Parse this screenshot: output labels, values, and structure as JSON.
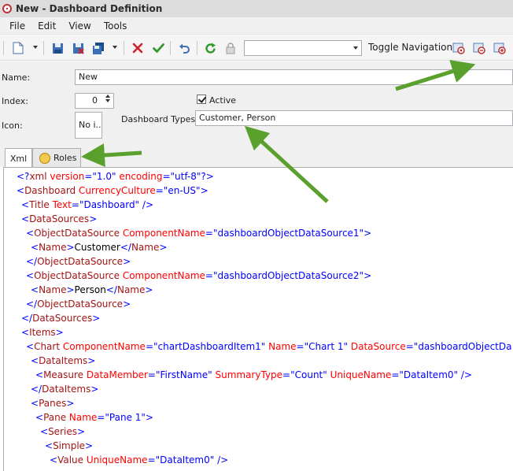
{
  "window": {
    "title": "New - Dashboard Definition"
  },
  "menu": [
    "File",
    "Edit",
    "View",
    "Tools"
  ],
  "toolbar": {
    "combo_value": "",
    "toggle_navigation": "Toggle Navigation"
  },
  "form": {
    "name_label": "Name:",
    "name_value": "New",
    "index_label": "Index:",
    "index_value": "0",
    "active_label": "Active",
    "active_checked": true,
    "icon_label": "Icon:",
    "icon_value": "No i...",
    "types_label": "Dashboard Types:",
    "types_value": "Customer, Person"
  },
  "tabs": [
    {
      "label": "Xml",
      "selected": true
    },
    {
      "label": "Roles",
      "selected": false
    }
  ],
  "xml_lines": [
    {
      "indent": 0,
      "tokens": [
        [
          "b",
          "<?"
        ],
        [
          "t",
          "xml"
        ],
        [
          "a",
          " version"
        ],
        [
          "b",
          "="
        ],
        [
          "v",
          "\"1.0\""
        ],
        [
          "a",
          " encoding"
        ],
        [
          "b",
          "="
        ],
        [
          "v",
          "\"utf-8\""
        ],
        [
          "b",
          "?>"
        ]
      ]
    },
    {
      "indent": 0,
      "tokens": [
        [
          "b",
          "<"
        ],
        [
          "t",
          "Dashboard"
        ],
        [
          "a",
          " CurrencyCulture"
        ],
        [
          "b",
          "="
        ],
        [
          "v",
          "\"en-US\""
        ],
        [
          "b",
          ">"
        ]
      ]
    },
    {
      "indent": 1,
      "tokens": [
        [
          "b",
          "<"
        ],
        [
          "t",
          "Title"
        ],
        [
          "a",
          " Text"
        ],
        [
          "b",
          "="
        ],
        [
          "v",
          "\"Dashboard\""
        ],
        [
          "b",
          " />"
        ]
      ]
    },
    {
      "indent": 1,
      "tokens": [
        [
          "b",
          "<"
        ],
        [
          "t",
          "DataSources"
        ],
        [
          "b",
          ">"
        ]
      ]
    },
    {
      "indent": 2,
      "tokens": [
        [
          "b",
          "<"
        ],
        [
          "t",
          "ObjectDataSource"
        ],
        [
          "a",
          " ComponentName"
        ],
        [
          "b",
          "="
        ],
        [
          "v",
          "\"dashboardObjectDataSource1\""
        ],
        [
          "b",
          ">"
        ]
      ]
    },
    {
      "indent": 3,
      "tokens": [
        [
          "b",
          "<"
        ],
        [
          "t",
          "Name"
        ],
        [
          "b",
          ">"
        ],
        [
          "x",
          "Customer"
        ],
        [
          "b",
          "</"
        ],
        [
          "t",
          "Name"
        ],
        [
          "b",
          ">"
        ]
      ]
    },
    {
      "indent": 2,
      "tokens": [
        [
          "b",
          "</"
        ],
        [
          "t",
          "ObjectDataSource"
        ],
        [
          "b",
          ">"
        ]
      ]
    },
    {
      "indent": 2,
      "tokens": [
        [
          "b",
          "<"
        ],
        [
          "t",
          "ObjectDataSource"
        ],
        [
          "a",
          " ComponentName"
        ],
        [
          "b",
          "="
        ],
        [
          "v",
          "\"dashboardObjectDataSource2\""
        ],
        [
          "b",
          ">"
        ]
      ]
    },
    {
      "indent": 3,
      "tokens": [
        [
          "b",
          "<"
        ],
        [
          "t",
          "Name"
        ],
        [
          "b",
          ">"
        ],
        [
          "x",
          "Person"
        ],
        [
          "b",
          "</"
        ],
        [
          "t",
          "Name"
        ],
        [
          "b",
          ">"
        ]
      ]
    },
    {
      "indent": 2,
      "tokens": [
        [
          "b",
          "</"
        ],
        [
          "t",
          "ObjectDataSource"
        ],
        [
          "b",
          ">"
        ]
      ]
    },
    {
      "indent": 1,
      "tokens": [
        [
          "b",
          "</"
        ],
        [
          "t",
          "DataSources"
        ],
        [
          "b",
          ">"
        ]
      ]
    },
    {
      "indent": 1,
      "tokens": [
        [
          "b",
          "<"
        ],
        [
          "t",
          "Items"
        ],
        [
          "b",
          ">"
        ]
      ]
    },
    {
      "indent": 2,
      "tokens": [
        [
          "b",
          "<"
        ],
        [
          "t",
          "Chart"
        ],
        [
          "a",
          " ComponentName"
        ],
        [
          "b",
          "="
        ],
        [
          "v",
          "\"chartDashboardItem1\""
        ],
        [
          "a",
          " Name"
        ],
        [
          "b",
          "="
        ],
        [
          "v",
          "\"Chart 1\""
        ],
        [
          "a",
          " DataSource"
        ],
        [
          "b",
          "="
        ],
        [
          "v",
          "\"dashboardObjectDa"
        ]
      ]
    },
    {
      "indent": 3,
      "tokens": [
        [
          "b",
          "<"
        ],
        [
          "t",
          "DataItems"
        ],
        [
          "b",
          ">"
        ]
      ]
    },
    {
      "indent": 4,
      "tokens": [
        [
          "b",
          "<"
        ],
        [
          "t",
          "Measure"
        ],
        [
          "a",
          " DataMember"
        ],
        [
          "b",
          "="
        ],
        [
          "v",
          "\"FirstName\""
        ],
        [
          "a",
          " SummaryType"
        ],
        [
          "b",
          "="
        ],
        [
          "v",
          "\"Count\""
        ],
        [
          "a",
          " UniqueName"
        ],
        [
          "b",
          "="
        ],
        [
          "v",
          "\"DataItem0\""
        ],
        [
          "b",
          " />"
        ]
      ]
    },
    {
      "indent": 3,
      "tokens": [
        [
          "b",
          "</"
        ],
        [
          "t",
          "DataItems"
        ],
        [
          "b",
          ">"
        ]
      ]
    },
    {
      "indent": 3,
      "tokens": [
        [
          "b",
          "<"
        ],
        [
          "t",
          "Panes"
        ],
        [
          "b",
          ">"
        ]
      ]
    },
    {
      "indent": 4,
      "tokens": [
        [
          "b",
          "<"
        ],
        [
          "t",
          "Pane"
        ],
        [
          "a",
          " Name"
        ],
        [
          "b",
          "="
        ],
        [
          "v",
          "\"Pane 1\""
        ],
        [
          "b",
          ">"
        ]
      ]
    },
    {
      "indent": 5,
      "tokens": [
        [
          "b",
          "<"
        ],
        [
          "t",
          "Series"
        ],
        [
          "b",
          ">"
        ]
      ]
    },
    {
      "indent": 6,
      "tokens": [
        [
          "b",
          "<"
        ],
        [
          "t",
          "Simple"
        ],
        [
          "b",
          ">"
        ]
      ]
    },
    {
      "indent": 7,
      "tokens": [
        [
          "b",
          "<"
        ],
        [
          "t",
          "Value"
        ],
        [
          "a",
          " UniqueName"
        ],
        [
          "b",
          "="
        ],
        [
          "v",
          "\"DataItem0\""
        ],
        [
          "b",
          " />"
        ]
      ]
    }
  ],
  "icons": [
    "app-icon",
    "new-document-icon",
    "save-icon",
    "save-close-icon",
    "save-multiple-icon",
    "delete-icon",
    "check-icon",
    "undo-icon",
    "refresh-icon",
    "lock-icon",
    "dashboard-icon-1",
    "dashboard-icon-2",
    "dashboard-icon-3",
    "roles-icon"
  ],
  "colors": {
    "xml_bracket": "#0000ff",
    "xml_tag": "#a31515",
    "xml_attr": "#ff0000",
    "xml_value": "#0000ff",
    "annotation_arrow": "#5aa02c"
  }
}
